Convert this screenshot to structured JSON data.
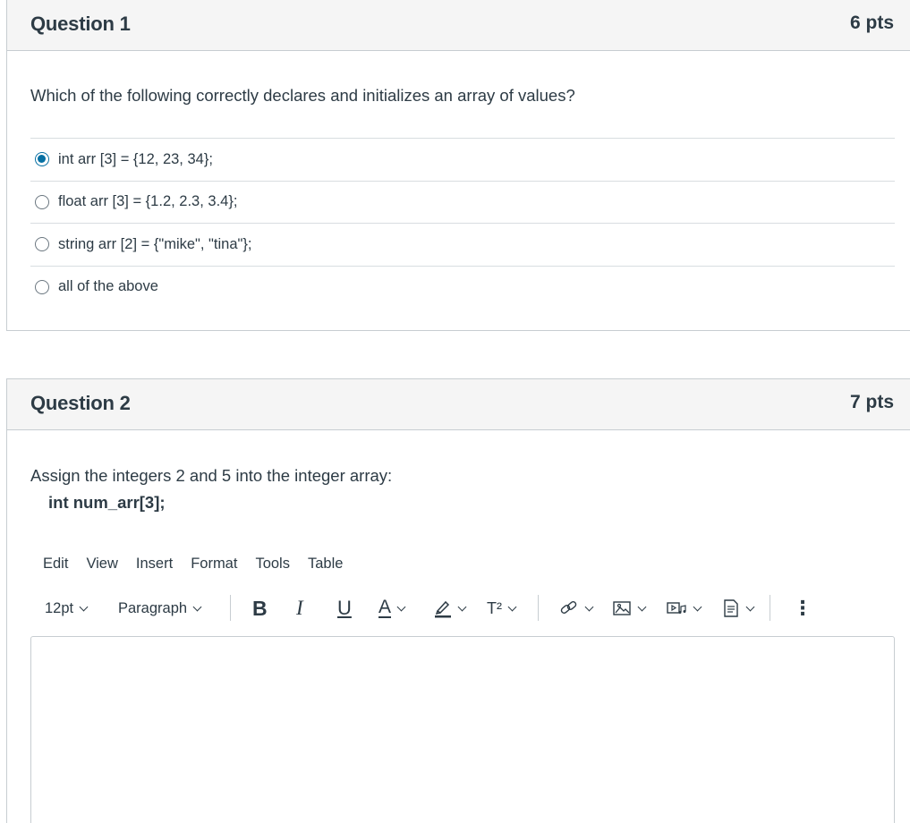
{
  "question1": {
    "title": "Question 1",
    "points": "6 pts",
    "text": "Which of the following correctly declares and initializes an array of values?",
    "answers": [
      {
        "label": "int arr [3] = {12, 23, 34};",
        "selected": true
      },
      {
        "label": "float arr [3] = {1.2, 2.3, 3.4};",
        "selected": false
      },
      {
        "label": "string arr [2] = {\"mike\", \"tina\"};",
        "selected": false
      },
      {
        "label": "all of the above",
        "selected": false
      }
    ]
  },
  "question2": {
    "title": "Question 2",
    "points": "7 pts",
    "text": "Assign the integers 2 and 5 into the integer array:",
    "code": "int num_arr[3];"
  },
  "editor": {
    "menu": [
      "Edit",
      "View",
      "Insert",
      "Format",
      "Tools",
      "Table"
    ],
    "font_size": "12pt",
    "block_format": "Paragraph",
    "bold": "B",
    "italic": "I",
    "underline": "U",
    "text_color": "A",
    "superscript": "T²",
    "more": "⋮",
    "content": ""
  },
  "colors": {
    "accent": "#0770a3",
    "text": "#2d3b45",
    "header_bg": "#f5f5f5",
    "border": "#c7cdd1"
  }
}
